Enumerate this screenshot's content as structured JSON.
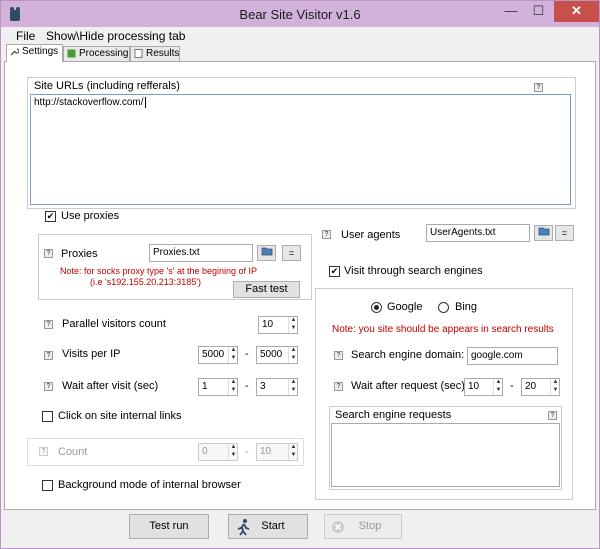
{
  "window": {
    "title": "Bear Site Visitor v1.6",
    "min": "—",
    "max": "☐",
    "close": "✕"
  },
  "menu": {
    "file": "File",
    "show_hide": "Show\\Hide processing tab"
  },
  "tabs": [
    {
      "label": "Settings"
    },
    {
      "label": "Processing"
    },
    {
      "label": "Results"
    }
  ],
  "help_glyph": "?",
  "site_urls": {
    "label": "Site URLs (including refferals)",
    "value": "http://stackoverflow.com/"
  },
  "use_proxies": {
    "label": "Use proxies",
    "check": "✔"
  },
  "proxies": {
    "label": "Proxies",
    "file": "Proxies.txt",
    "note1": "Note: for socks proxy type 's' at the begining of IP",
    "note2": "(i.e 's192.155.20.213:3185')",
    "fast_test": "Fast test",
    "browse_icon": "folder-icon",
    "edit_icon": "list-icon",
    "edit_glyph": "="
  },
  "parallel": {
    "label": "Parallel visitors count",
    "value": "10"
  },
  "visits_per_ip": {
    "label": "Visits per IP",
    "min": "5000",
    "max": "5000"
  },
  "wait_after_visit": {
    "label": "Wait after visit (sec)",
    "min": "1",
    "max": "3"
  },
  "click_internal": {
    "label": "Click on site internal links"
  },
  "count": {
    "label": "Count",
    "min": "0",
    "max": "10"
  },
  "range_sep": "-",
  "background_mode": {
    "label": "Background mode of internal browser"
  },
  "user_agents": {
    "label": "User agents",
    "file": "UserAgents.txt"
  },
  "visit_search": {
    "label": "Visit through search engines",
    "check": "✔"
  },
  "engines": {
    "google": "Google",
    "bing": "Bing",
    "note": "Note: you site should be appears in search results"
  },
  "search_domain": {
    "label": "Search engine domain:",
    "value": "google.com"
  },
  "wait_after_request": {
    "label": "Wait after request (sec)",
    "min": "10",
    "max": "20"
  },
  "search_requests": {
    "label": "Search engine requests"
  },
  "buttons": {
    "test_run": "Test run",
    "start": "Start",
    "stop": "Stop"
  },
  "colors": {
    "titlebar": "#d2b2da",
    "close": "#c7504a",
    "note_red": "#c00000"
  }
}
